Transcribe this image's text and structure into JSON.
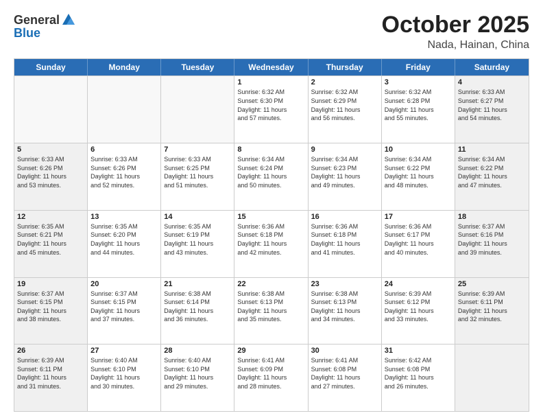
{
  "header": {
    "logo_general": "General",
    "logo_blue": "Blue",
    "month": "October 2025",
    "location": "Nada, Hainan, China"
  },
  "weekdays": [
    "Sunday",
    "Monday",
    "Tuesday",
    "Wednesday",
    "Thursday",
    "Friday",
    "Saturday"
  ],
  "rows": [
    [
      {
        "day": "",
        "text": "",
        "empty": true
      },
      {
        "day": "",
        "text": "",
        "empty": true
      },
      {
        "day": "",
        "text": "",
        "empty": true
      },
      {
        "day": "1",
        "text": "Sunrise: 6:32 AM\nSunset: 6:30 PM\nDaylight: 11 hours\nand 57 minutes.",
        "empty": false
      },
      {
        "day": "2",
        "text": "Sunrise: 6:32 AM\nSunset: 6:29 PM\nDaylight: 11 hours\nand 56 minutes.",
        "empty": false
      },
      {
        "day": "3",
        "text": "Sunrise: 6:32 AM\nSunset: 6:28 PM\nDaylight: 11 hours\nand 55 minutes.",
        "empty": false
      },
      {
        "day": "4",
        "text": "Sunrise: 6:33 AM\nSunset: 6:27 PM\nDaylight: 11 hours\nand 54 minutes.",
        "empty": false,
        "shaded": true
      }
    ],
    [
      {
        "day": "5",
        "text": "Sunrise: 6:33 AM\nSunset: 6:26 PM\nDaylight: 11 hours\nand 53 minutes.",
        "empty": false,
        "shaded": true
      },
      {
        "day": "6",
        "text": "Sunrise: 6:33 AM\nSunset: 6:26 PM\nDaylight: 11 hours\nand 52 minutes.",
        "empty": false
      },
      {
        "day": "7",
        "text": "Sunrise: 6:33 AM\nSunset: 6:25 PM\nDaylight: 11 hours\nand 51 minutes.",
        "empty": false
      },
      {
        "day": "8",
        "text": "Sunrise: 6:34 AM\nSunset: 6:24 PM\nDaylight: 11 hours\nand 50 minutes.",
        "empty": false
      },
      {
        "day": "9",
        "text": "Sunrise: 6:34 AM\nSunset: 6:23 PM\nDaylight: 11 hours\nand 49 minutes.",
        "empty": false
      },
      {
        "day": "10",
        "text": "Sunrise: 6:34 AM\nSunset: 6:22 PM\nDaylight: 11 hours\nand 48 minutes.",
        "empty": false
      },
      {
        "day": "11",
        "text": "Sunrise: 6:34 AM\nSunset: 6:22 PM\nDaylight: 11 hours\nand 47 minutes.",
        "empty": false,
        "shaded": true
      }
    ],
    [
      {
        "day": "12",
        "text": "Sunrise: 6:35 AM\nSunset: 6:21 PM\nDaylight: 11 hours\nand 45 minutes.",
        "empty": false,
        "shaded": true
      },
      {
        "day": "13",
        "text": "Sunrise: 6:35 AM\nSunset: 6:20 PM\nDaylight: 11 hours\nand 44 minutes.",
        "empty": false
      },
      {
        "day": "14",
        "text": "Sunrise: 6:35 AM\nSunset: 6:19 PM\nDaylight: 11 hours\nand 43 minutes.",
        "empty": false
      },
      {
        "day": "15",
        "text": "Sunrise: 6:36 AM\nSunset: 6:18 PM\nDaylight: 11 hours\nand 42 minutes.",
        "empty": false
      },
      {
        "day": "16",
        "text": "Sunrise: 6:36 AM\nSunset: 6:18 PM\nDaylight: 11 hours\nand 41 minutes.",
        "empty": false
      },
      {
        "day": "17",
        "text": "Sunrise: 6:36 AM\nSunset: 6:17 PM\nDaylight: 11 hours\nand 40 minutes.",
        "empty": false
      },
      {
        "day": "18",
        "text": "Sunrise: 6:37 AM\nSunset: 6:16 PM\nDaylight: 11 hours\nand 39 minutes.",
        "empty": false,
        "shaded": true
      }
    ],
    [
      {
        "day": "19",
        "text": "Sunrise: 6:37 AM\nSunset: 6:15 PM\nDaylight: 11 hours\nand 38 minutes.",
        "empty": false,
        "shaded": true
      },
      {
        "day": "20",
        "text": "Sunrise: 6:37 AM\nSunset: 6:15 PM\nDaylight: 11 hours\nand 37 minutes.",
        "empty": false
      },
      {
        "day": "21",
        "text": "Sunrise: 6:38 AM\nSunset: 6:14 PM\nDaylight: 11 hours\nand 36 minutes.",
        "empty": false
      },
      {
        "day": "22",
        "text": "Sunrise: 6:38 AM\nSunset: 6:13 PM\nDaylight: 11 hours\nand 35 minutes.",
        "empty": false
      },
      {
        "day": "23",
        "text": "Sunrise: 6:38 AM\nSunset: 6:13 PM\nDaylight: 11 hours\nand 34 minutes.",
        "empty": false
      },
      {
        "day": "24",
        "text": "Sunrise: 6:39 AM\nSunset: 6:12 PM\nDaylight: 11 hours\nand 33 minutes.",
        "empty": false
      },
      {
        "day": "25",
        "text": "Sunrise: 6:39 AM\nSunset: 6:11 PM\nDaylight: 11 hours\nand 32 minutes.",
        "empty": false,
        "shaded": true
      }
    ],
    [
      {
        "day": "26",
        "text": "Sunrise: 6:39 AM\nSunset: 6:11 PM\nDaylight: 11 hours\nand 31 minutes.",
        "empty": false,
        "shaded": true
      },
      {
        "day": "27",
        "text": "Sunrise: 6:40 AM\nSunset: 6:10 PM\nDaylight: 11 hours\nand 30 minutes.",
        "empty": false
      },
      {
        "day": "28",
        "text": "Sunrise: 6:40 AM\nSunset: 6:10 PM\nDaylight: 11 hours\nand 29 minutes.",
        "empty": false
      },
      {
        "day": "29",
        "text": "Sunrise: 6:41 AM\nSunset: 6:09 PM\nDaylight: 11 hours\nand 28 minutes.",
        "empty": false
      },
      {
        "day": "30",
        "text": "Sunrise: 6:41 AM\nSunset: 6:08 PM\nDaylight: 11 hours\nand 27 minutes.",
        "empty": false
      },
      {
        "day": "31",
        "text": "Sunrise: 6:42 AM\nSunset: 6:08 PM\nDaylight: 11 hours\nand 26 minutes.",
        "empty": false
      },
      {
        "day": "",
        "text": "",
        "empty": true,
        "shaded": true
      }
    ]
  ]
}
